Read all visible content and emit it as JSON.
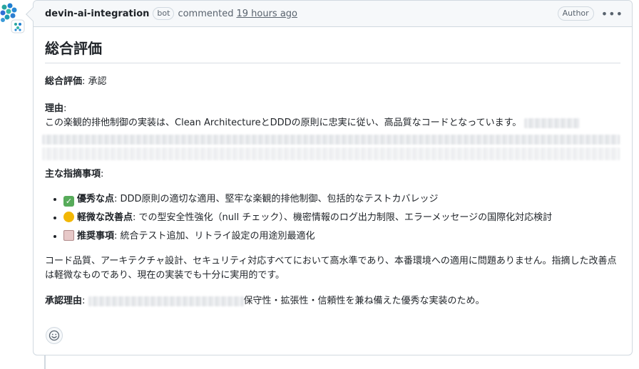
{
  "comment": {
    "author": "devin-ai-integration",
    "bot_badge": "bot",
    "action": "commented",
    "time": "19 hours ago",
    "author_badge": "Author",
    "more": "•••"
  },
  "content": {
    "heading": "総合評価",
    "overall_label": "総合評価",
    "overall_value": ": 承認",
    "reason_label": "理由",
    "reason_colon": ":",
    "reason_text": "この楽観的排他制御の実装は、Clean ArchitectureとDDDの原則に忠実に従い、高品質なコードとなっています。",
    "points_label": "主な指摘事項",
    "points_colon": ":",
    "points": [
      {
        "icon": "check-mark-icon",
        "label": "優秀な点",
        "text": ": DDD原則の適切な適用、堅牢な楽観的排他制御、包括的なテストカバレッジ"
      },
      {
        "icon": "face-icon",
        "label": "軽微な改善点",
        "text": ": での型安全性強化（null チェック）、機密情報のログ出力制限、エラーメッセージの国際化対応検討"
      },
      {
        "icon": "clipboard-icon",
        "label": "推奨事項",
        "text": ": 統合テスト追加、リトライ設定の用途別最適化"
      }
    ],
    "summary": "コード品質、アーキテクチャ設計、セキュリティ対応すべてにおいて高水準であり、本番環境への適用に問題ありません。指摘した改善点は軽微なものであり、現在の実装でも十分に実用的です。",
    "approval_label": "承認理由",
    "approval_colon": ":",
    "approval_text": "保守性・拡張性・信頼性を兼ね備えた優秀な実装のため。"
  },
  "colors": {
    "border": "#d1d9e0",
    "header_bg": "#f6f8fa",
    "muted": "#59636e",
    "text": "#1f2328"
  }
}
